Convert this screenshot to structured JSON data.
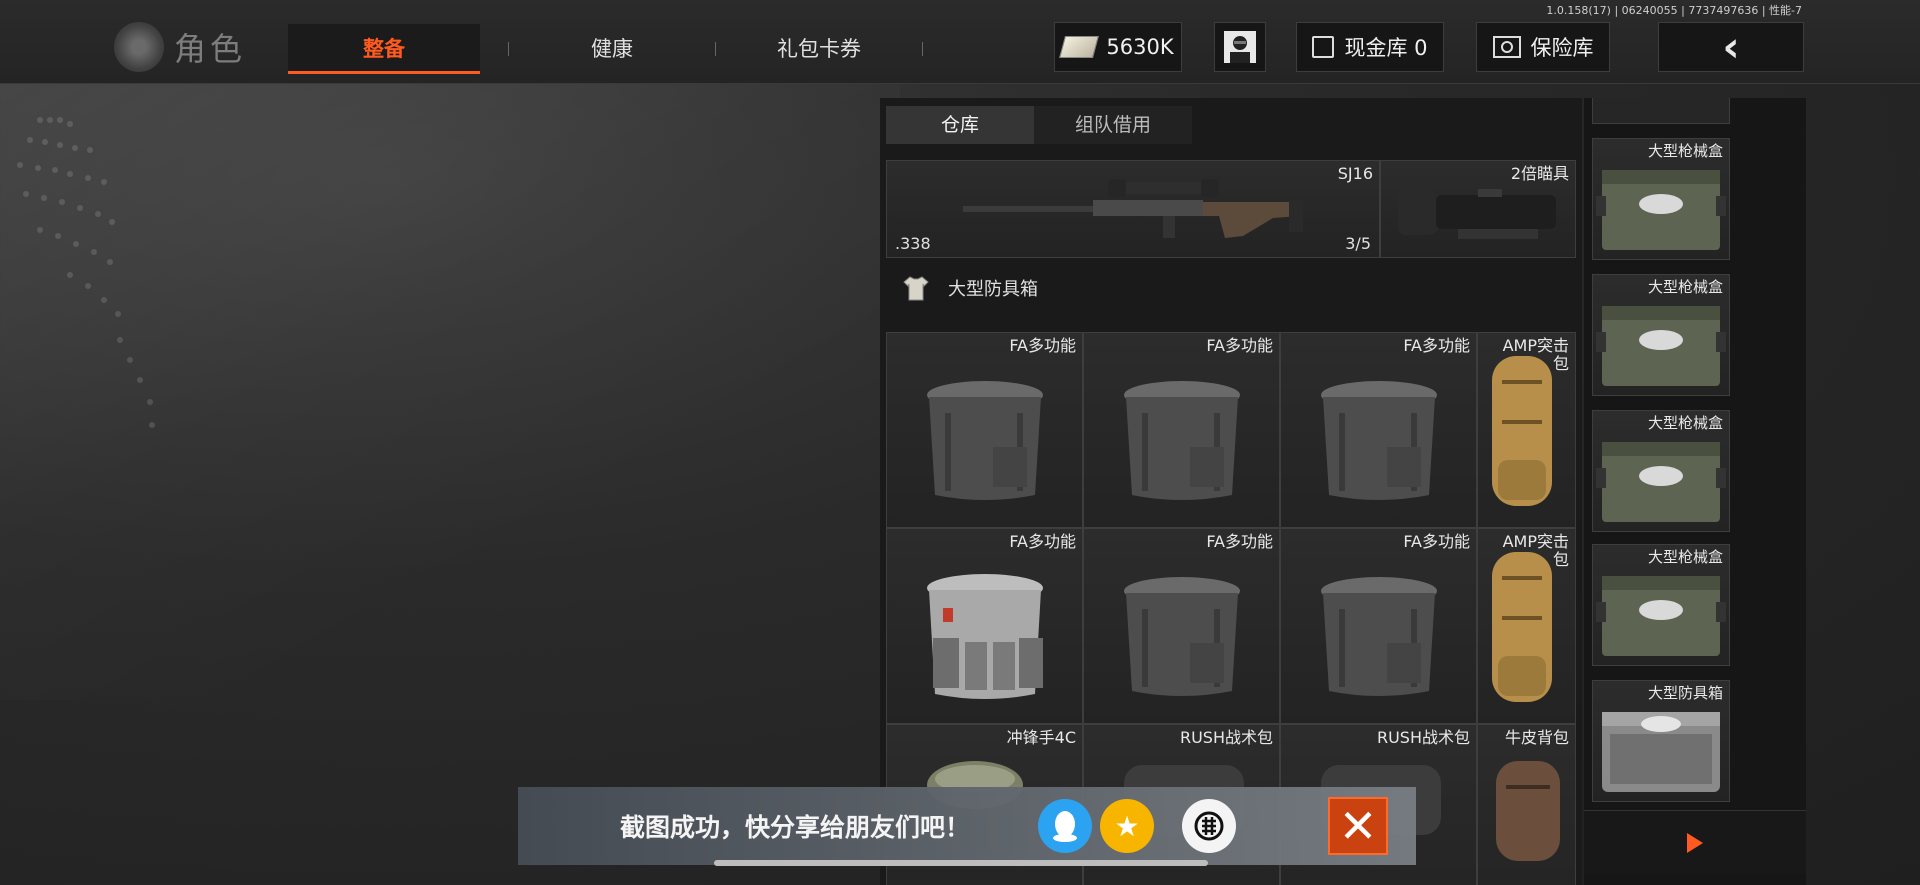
{
  "version": "1.0.158(17) | 06240055 | 7737497636 | 性能-7",
  "header": {
    "role_label": "角色",
    "tabs": [
      {
        "label": "整备",
        "active": true
      },
      {
        "label": "健康",
        "active": false
      },
      {
        "label": "礼包卡券",
        "active": false
      }
    ],
    "cash_value": "5630K",
    "cash_vault_label": "现金库 0",
    "safe_label": "保险库"
  },
  "inventory": {
    "subtabs": [
      "仓库",
      "组队借用"
    ],
    "weapon": {
      "name": "SJ16",
      "caliber": ".338",
      "ammo": "3/5"
    },
    "scope": {
      "name": "2倍瞄具"
    },
    "section_title": "大型防具箱",
    "rows": [
      [
        "FA多功能",
        "FA多功能",
        "FA多功能",
        "AMP突击包"
      ],
      [
        "FA多功能",
        "FA多功能",
        "FA多功能",
        "AMP突击包"
      ],
      [
        "冲锋手4C",
        "RUSH战术包",
        "RUSH战术包",
        "牛皮背包"
      ]
    ]
  },
  "right_column": {
    "items": [
      "大型枪械盒",
      "大型枪械盒",
      "大型枪械盒",
      "大型枪械盒",
      "大型防具箱"
    ]
  },
  "toast": {
    "message": "截图成功，快分享给朋友们吧！",
    "share_targets": [
      "qq-icon",
      "qzone-icon",
      "share-other-icon"
    ]
  },
  "colors": {
    "accent": "#ff5a1f",
    "panel": "#1a1a1a",
    "toast_close": "#c9420f"
  }
}
